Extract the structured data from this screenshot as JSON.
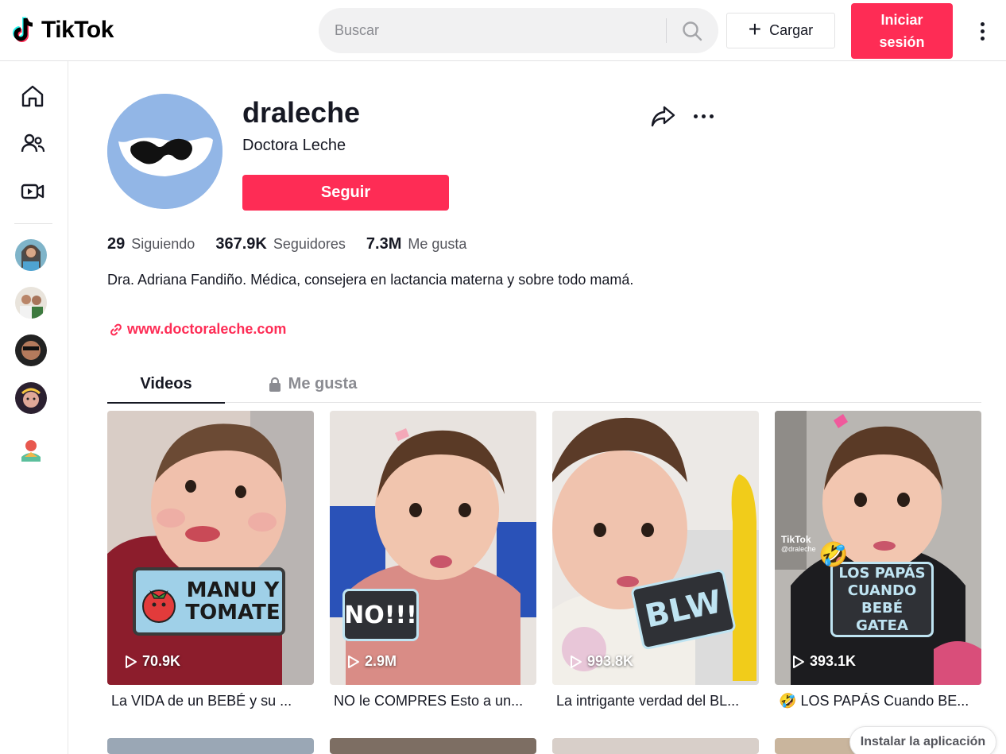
{
  "header": {
    "logo_text": "TikTok",
    "search_placeholder": "Buscar",
    "upload_label": "Cargar",
    "login_label": "Iniciar sesión"
  },
  "profile": {
    "username": "draleche",
    "nickname": "Doctora Leche",
    "follow_label": "Seguir",
    "stats": {
      "following_count": "29",
      "following_label": "Siguiendo",
      "followers_count": "367.9K",
      "followers_label": "Seguidores",
      "likes_count": "7.3M",
      "likes_label": "Me gusta"
    },
    "bio": "Dra. Adriana Fandiño. Médica, consejera en lactancia materna y sobre todo mamá.",
    "link": "www.doctoraleche.com"
  },
  "tabs": [
    {
      "label": "Videos"
    },
    {
      "label": "Me gusta"
    }
  ],
  "videos": [
    {
      "views": "70.9K",
      "caption": "La VIDA de un BEBÉ y su ...",
      "sticker": "MANU Y TOMATE",
      "caption_emoji": ""
    },
    {
      "views": "2.9M",
      "caption": "NO le COMPRES Esto a un...",
      "sticker": "NO!!!",
      "caption_emoji": ""
    },
    {
      "views": "993.8K",
      "caption": "La intrigante verdad del BL...",
      "sticker": "BLW",
      "caption_emoji": ""
    },
    {
      "views": "393.1K",
      "caption": "LOS PAPÁS Cuando BE...",
      "sticker": "LOS PAPÁS CUANDO BEBÉ GATEA",
      "caption_emoji": "🤣",
      "watermark_brand": "TikTok",
      "watermark_user": "@draleche"
    }
  ],
  "install_label": "Instalar la aplicación",
  "colors": {
    "brand": "#fe2c55",
    "text": "#161823",
    "muted": "#8a8b91"
  }
}
